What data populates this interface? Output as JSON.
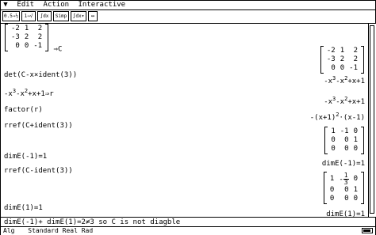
{
  "menubar": {
    "arrow": "▼",
    "items": [
      "Edit",
      "Action",
      "Interactive"
    ]
  },
  "toolbar": {
    "buttons": [
      "0.5⇒½",
      "1⇒√",
      "∫dx",
      "Simp",
      "∫dx▾",
      "↔"
    ]
  },
  "entries": {
    "def_matrix": [
      [
        "-2",
        "1",
        "2"
      ],
      [
        "-3",
        "2",
        "2"
      ],
      [
        "0",
        "0",
        "-1"
      ]
    ],
    "def_suffix": "⇒C",
    "res_matrix": [
      [
        "-2",
        "1",
        "2"
      ],
      [
        "-3",
        "2",
        "2"
      ],
      [
        "0",
        "0",
        "-1"
      ]
    ],
    "det_input": "det(C-x×ident(3))",
    "det_result_a": "-x",
    "det_result_b": "-x",
    "det_result_c": "+x+1",
    "r_input_a": "-x",
    "r_input_b": "-x",
    "r_input_c": "+x+1⇒r",
    "r_result_a": "-x",
    "r_result_b": "-x",
    "r_result_c": "+x+1",
    "sup3": "3",
    "sup2": "2",
    "factor_input": "factor(r)",
    "factor_result_a": "-(x+1)",
    "factor_result_b": "·(x-1)",
    "rref1_input": "rref(C+ident(3))",
    "rref1_matrix": [
      [
        "1",
        "-1",
        "0"
      ],
      [
        "0",
        "0",
        "1"
      ],
      [
        "0",
        "0",
        "0"
      ]
    ],
    "dim1_input": "dimE(-1)=1",
    "dim1_result": "dimE(-1)=1",
    "rref2_input": "rref(C-ident(3))",
    "rref2_row1_a": "1",
    "rref2_frac_num": "1",
    "rref2_frac_den": "3",
    "rref2_row1_c": "0",
    "rref2_row1_sign": "-",
    "rref2_rows": [
      [
        "0",
        "0",
        "1"
      ],
      [
        "0",
        "0",
        "0"
      ]
    ],
    "dim2_input": "dimE(1)=1",
    "dim2_result": "dimE(1)=1",
    "last_input": "dimE(-1)+ dimE(1)=2≠3 so C is not diagble"
  },
  "status": {
    "mode": "Alg",
    "settings": "Standard Real Rad"
  }
}
